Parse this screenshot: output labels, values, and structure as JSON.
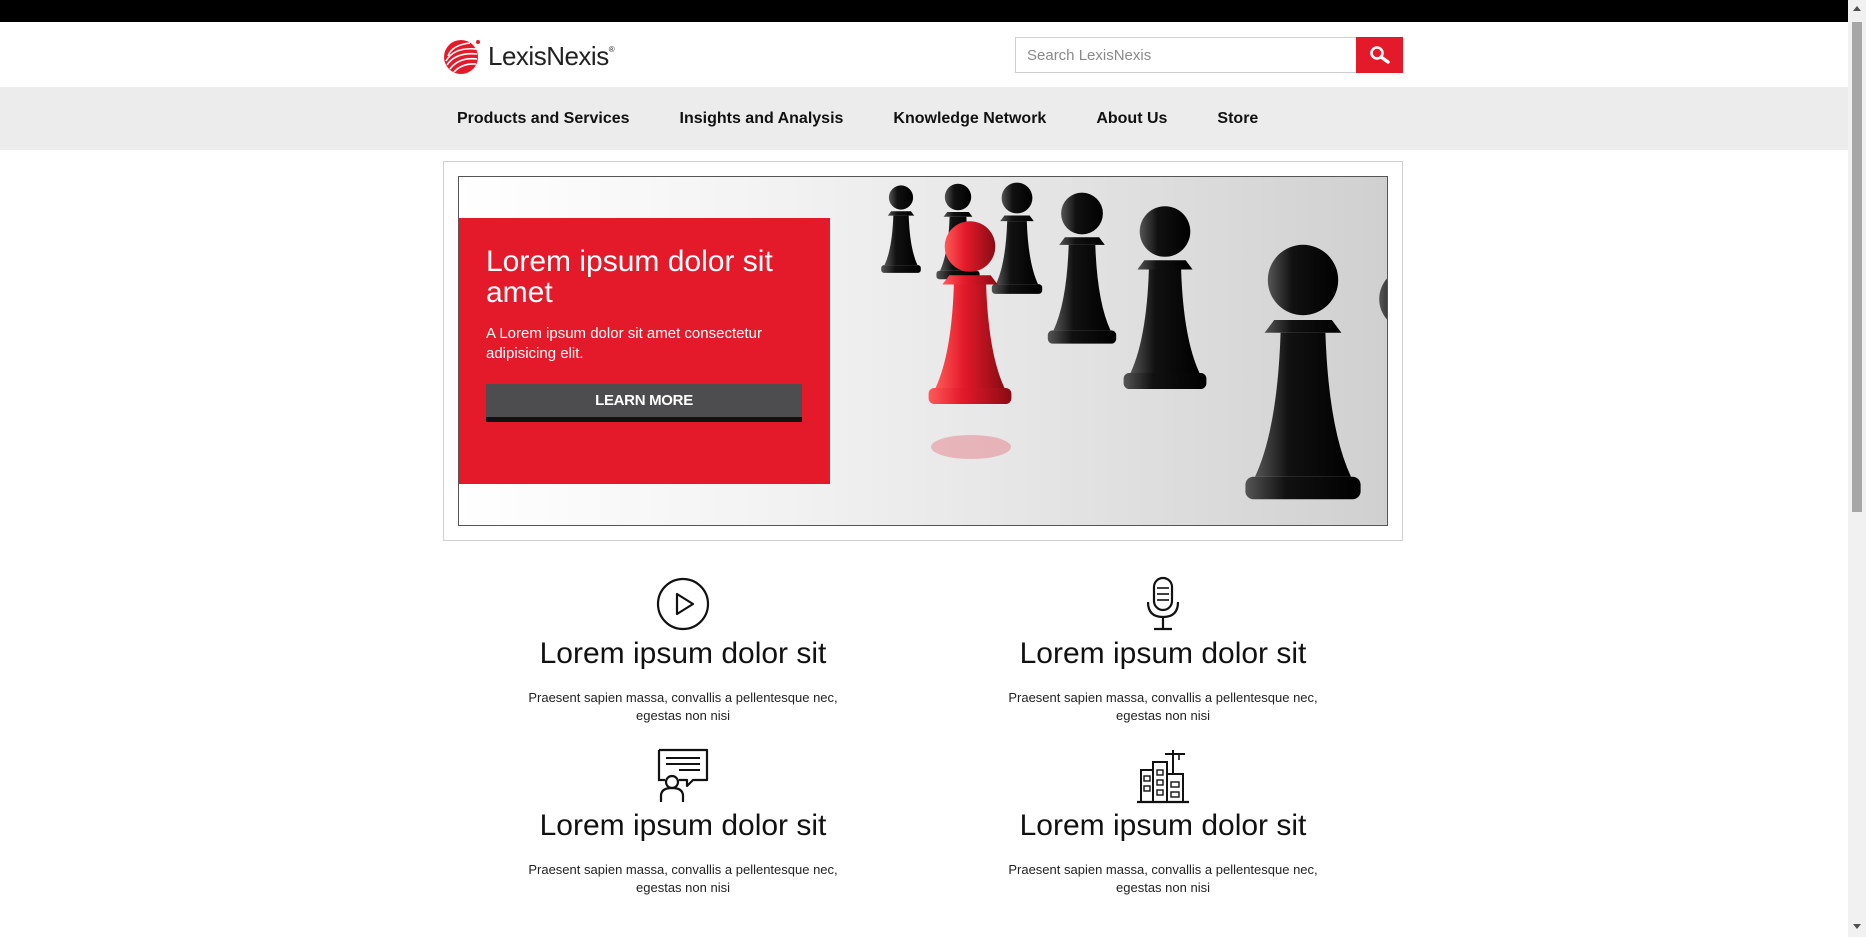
{
  "brand": {
    "name": "LexisNexis",
    "mark": "®",
    "accent": "#e41a2a"
  },
  "search": {
    "placeholder": "Search LexisNexis",
    "button_icon": "search-icon"
  },
  "nav": {
    "items": [
      {
        "label": "Products and Services"
      },
      {
        "label": "Insights and Analysis"
      },
      {
        "label": "Knowledge Network"
      },
      {
        "label": "About Us"
      },
      {
        "label": "Store"
      }
    ]
  },
  "hero": {
    "title": "Lorem ipsum dolor sit amet",
    "description": "A Lorem ipsum dolor sit amet consectetur adipisicing elit.",
    "button_label": "LEARN MORE",
    "image": "chess-pawns-image"
  },
  "features": [
    {
      "icon": "play-icon",
      "title": "Lorem ipsum dolor sit",
      "text": "Praesent sapien massa, convallis a pellentesque nec, egestas non nisi"
    },
    {
      "icon": "microphone-icon",
      "title": "Lorem ipsum dolor sit",
      "text": "Praesent sapien massa, convallis a pellentesque nec, egestas non nisi"
    },
    {
      "icon": "presenter-icon",
      "title": "Lorem ipsum dolor sit",
      "text": "Praesent sapien massa, convallis a pellentesque nec, egestas non nisi"
    },
    {
      "icon": "city-buildings-icon",
      "title": "Lorem ipsum dolor sit",
      "text": "Praesent sapien massa, convallis a pellentesque nec, egestas non nisi"
    }
  ]
}
